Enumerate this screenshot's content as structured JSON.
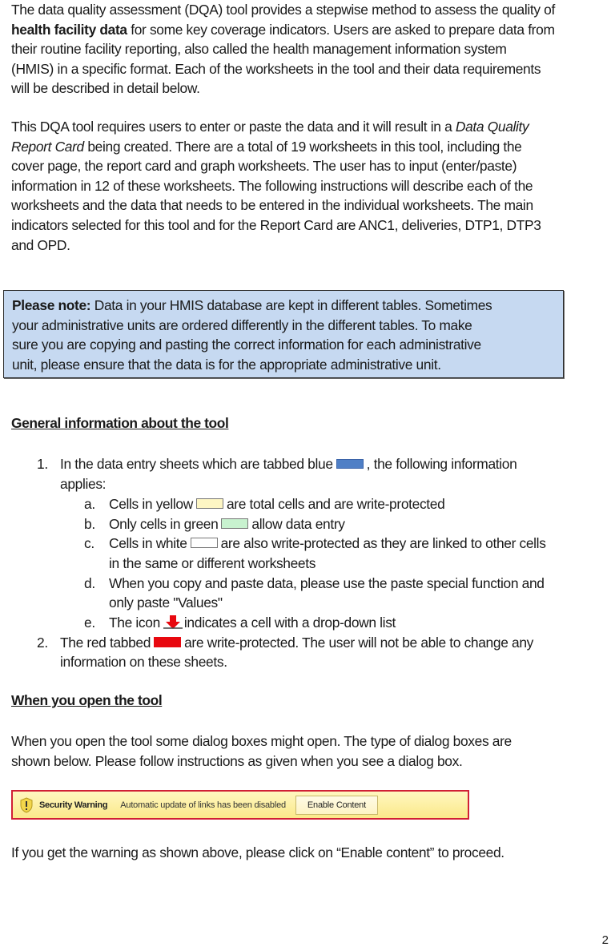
{
  "intro": {
    "p1_lines": [
      {
        "pre": "The data quality assessment (DQA) tool provides a stepwise method to assess the quality of",
        "bold": "",
        "post": ""
      },
      {
        "pre": "",
        "bold": "health facility data",
        "post": " for some key coverage indicators.  Users are asked to prepare data from"
      },
      {
        "pre": "their routine facility reporting, also called the health management information system",
        "bold": "",
        "post": ""
      },
      {
        "pre": "(HMIS) in a specific format.  Each of the worksheets in the tool and their data requirements",
        "bold": "",
        "post": ""
      },
      {
        "pre": "will be described in detail below.",
        "bold": "",
        "post": ""
      }
    ],
    "p2_line1_pre": "This DQA tool requires users to enter or paste the data and it will result in a ",
    "p2_line1_italic": "Data Quality",
    "p2_line2_italic": "Report Card",
    "p2_line2_post": " being created.  There are a total of 19 worksheets in this tool, including the",
    "p2_rest": [
      "cover page, the report card and graph worksheets.  The user has to input (enter/paste)",
      "information in 12 of these worksheets.  The following instructions will describe each of the",
      "worksheets and the data that needs to be entered in the individual worksheets.  The main",
      "indicators selected for this tool and for the Report Card are ANC1, deliveries, DTP1, DTP3",
      "and OPD."
    ]
  },
  "note": {
    "label": "Please note:",
    "line1": " Data in your HMIS database are kept in different tables.  Sometimes",
    "lines": [
      "your administrative units are ordered differently in the different tables. To make",
      "sure you are copying and pasting the correct information for each administrative",
      "unit, please ensure that the data is for the appropriate administrative unit."
    ]
  },
  "general": {
    "heading": "General information about the tool",
    "item1": {
      "num": "1.",
      "pre": "In the data entry sheets which are tabbed blue",
      "post": ", the following information",
      "cont": "applies:"
    },
    "subitems": [
      {
        "letter": "a.",
        "pre": "Cells in yellow",
        "post": "are total cells and are write-protected",
        "cont": ""
      },
      {
        "letter": "b.",
        "pre": "Only cells in green",
        "post": "allow data entry",
        "cont": ""
      },
      {
        "letter": "c.",
        "pre": "Cells in white",
        "post": "are also write-protected as they are linked to other cells",
        "cont": "in the same or different worksheets"
      },
      {
        "letter": "d.",
        "pre": "When you copy and paste data, please use the paste special function and",
        "post": "",
        "cont": "only paste \"Values\""
      },
      {
        "letter": "e.",
        "pre": "The icon",
        "post": "indicates a cell with a drop-down list",
        "cont": ""
      }
    ],
    "item2": {
      "num": "2.",
      "pre": "The red tabbed",
      "post": "are write-protected.  The user will not be able to change any",
      "cont": "information on these sheets."
    },
    "colors": {
      "blue_tab": "#4f7fc6",
      "yellow_cell": "#fdf6c4",
      "green_cell": "#c8f2cf",
      "white_cell": "#ffffff",
      "red_tab": "#e8080f"
    }
  },
  "open": {
    "heading": "When you open the tool",
    "lines": [
      "When you open the tool some dialog boxes might open.  The type of dialog boxes are",
      "shown below.  Please follow instructions as given when you see a dialog box."
    ],
    "security_bar": {
      "icon": "warning-shield-icon",
      "title": "Security Warning",
      "message": "Automatic update of links has been disabled",
      "button": "Enable Content"
    },
    "after": "If you get the warning as shown above, please click on “Enable content” to proceed."
  },
  "page_number": "2"
}
